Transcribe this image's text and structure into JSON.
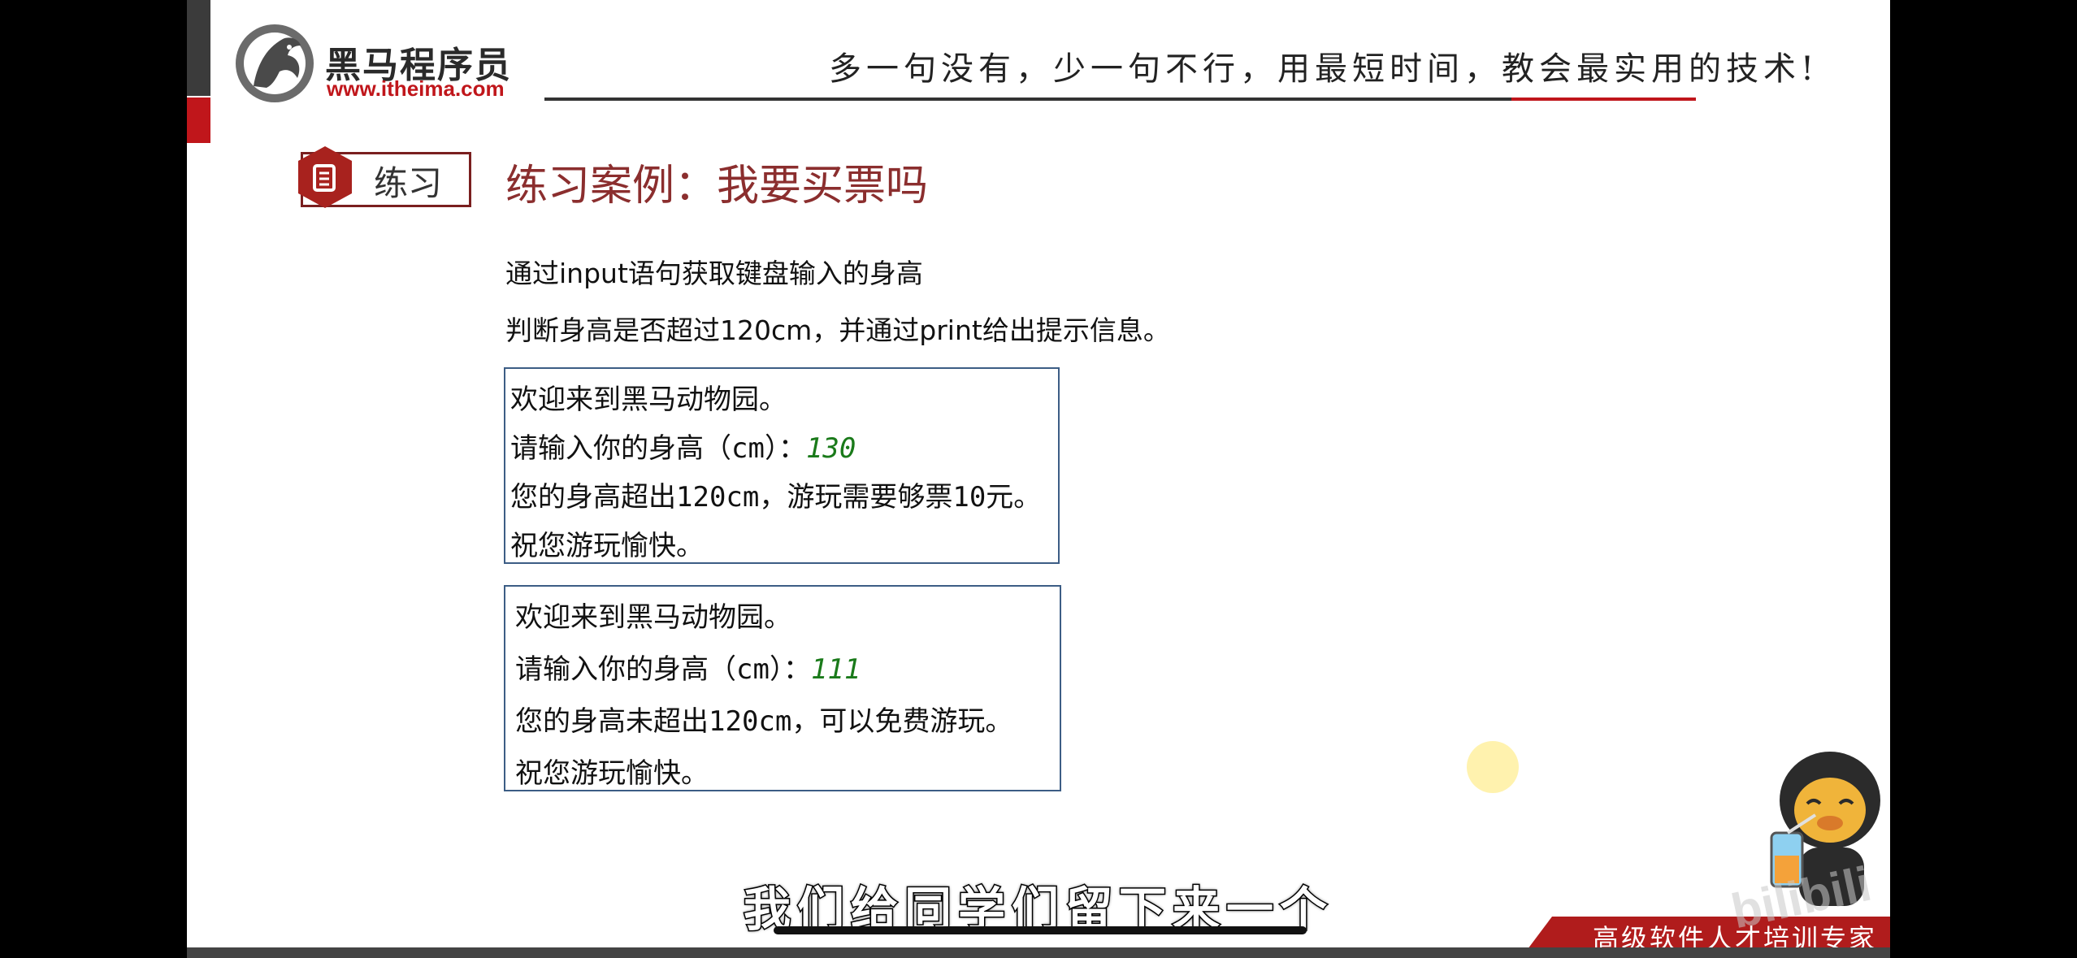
{
  "header": {
    "brand_name": "黑马程序员",
    "brand_url": "www.itheima.com",
    "slogan": "多一句没有，少一句不行，用最短时间，教会最实用的技术!"
  },
  "badge": {
    "label": "练习",
    "icon": "list-icon"
  },
  "title": "练习案例：我要买票吗",
  "description": [
    "通过input语句获取键盘输入的身高",
    "判断身高是否超过120cm，并通过print给出提示信息。"
  ],
  "examples": [
    {
      "welcome": "欢迎来到黑马动物园。",
      "prompt": "请输入你的身高（cm）：",
      "input_value": "130",
      "result": "您的身高超出120cm，游玩需要够票10元。",
      "farewell": "祝您游玩愉快。"
    },
    {
      "welcome": "欢迎来到黑马动物园。",
      "prompt": "请输入你的身高（cm）：",
      "input_value": "111",
      "result": "您的身高未超出120cm，可以免费游玩。",
      "farewell": "祝您游玩愉快。"
    }
  ],
  "footer": {
    "tagline": "高级软件人才培训专家",
    "watermark": "bilibili"
  },
  "subtitle": "我们给同学们留下来一个",
  "colors": {
    "brand_red": "#c0161b",
    "title_red": "#8b2e2e",
    "input_green": "#1a7a1a",
    "console_border": "#3c5d85"
  }
}
